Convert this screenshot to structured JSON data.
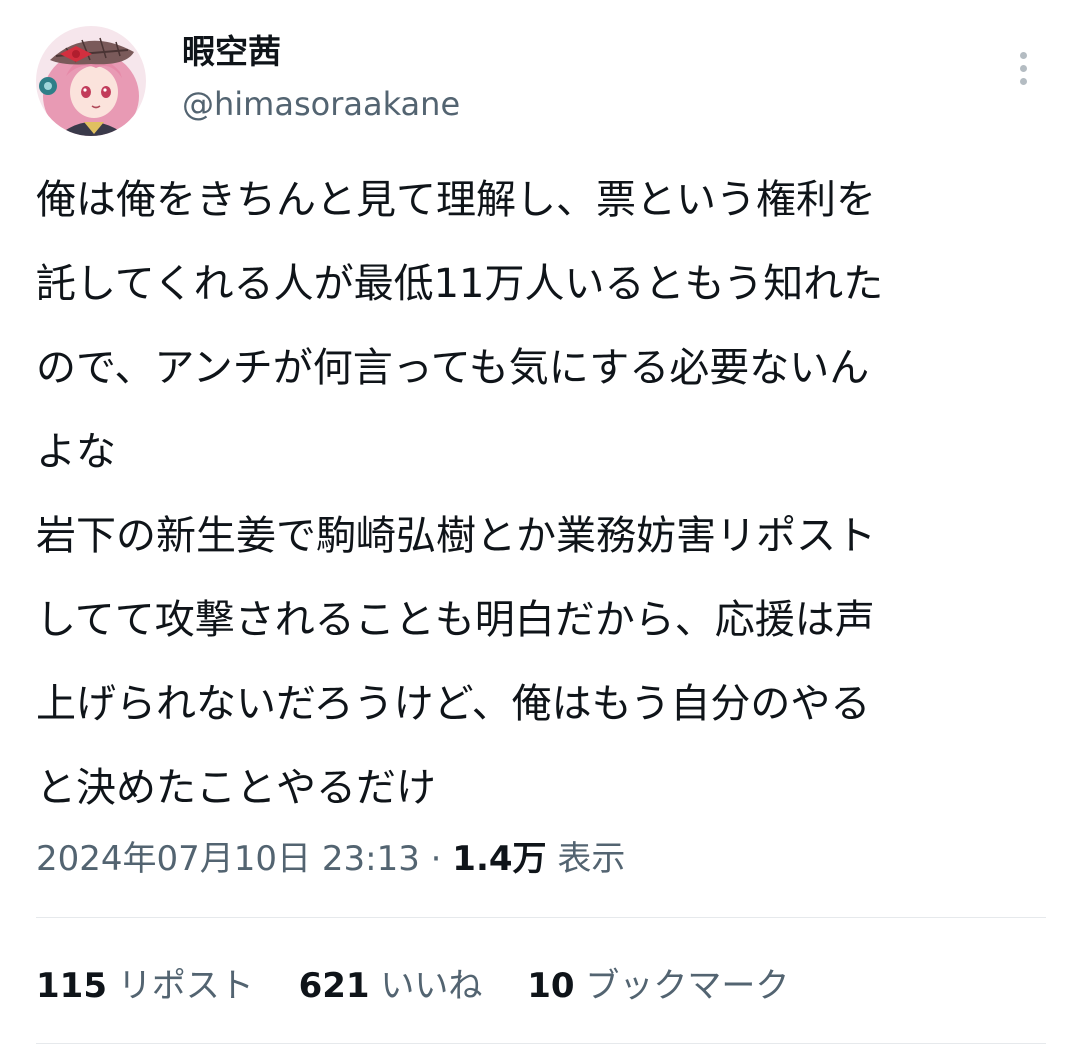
{
  "user": {
    "display_name": "暇空茜",
    "handle": "@himasoraakane",
    "avatar_icon": "anime-avatar-icon"
  },
  "tweet": {
    "lines": [
      "俺は俺をきちんと見て理解し、票という権利を",
      "託してくれる人が最低11万人いるともう知れた",
      "ので、アンチが何言っても気にする必要ないん",
      "よな",
      "岩下の新生姜で駒崎弘樹とか業務妨害リポスト",
      "してて攻撃されることも明白だから、応援は声",
      "上げられないだろうけど、俺はもう自分のやる",
      "と決めたことやるだけ"
    ]
  },
  "meta": {
    "timestamp": "2024年07月10日 23:13",
    "separator": "·",
    "views_count": "1.4万",
    "views_label": "表示"
  },
  "stats": {
    "reposts_count": "115",
    "reposts_label": "リポスト",
    "likes_count": "621",
    "likes_label": "いいね",
    "bookmarks_count": "10",
    "bookmarks_label": "ブックマーク"
  },
  "icons": {
    "more": "more-vertical-icon"
  },
  "colors": {
    "text_primary": "#0f1419",
    "text_secondary": "#536471",
    "divider": "#e6e9ec"
  }
}
